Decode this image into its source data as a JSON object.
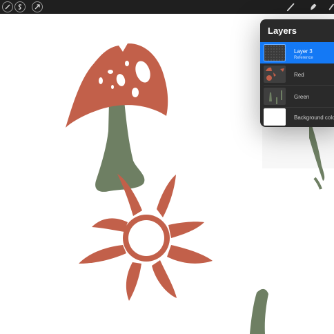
{
  "toolbar": {
    "left_tools": [
      "adjustments-icon",
      "selection-s-icon",
      "transform-arrow-icon"
    ],
    "right_tools": [
      "brush-icon",
      "smudge-icon",
      "eraser-icon"
    ]
  },
  "layers_panel": {
    "title": "Layers",
    "layers": [
      {
        "name": "Layer 3",
        "subtitle": "Reference",
        "active": true
      },
      {
        "name": "Red",
        "active": false
      },
      {
        "name": "Green",
        "active": false
      },
      {
        "name": "Background color",
        "active": false
      }
    ]
  },
  "colors": {
    "accent": "#1479f5",
    "toolbar": "#1f1f1f",
    "panel": "#2a2a2a",
    "red_layer": "#c2604a",
    "green_layer": "#6e7f63",
    "canvas": "#ffffff"
  }
}
